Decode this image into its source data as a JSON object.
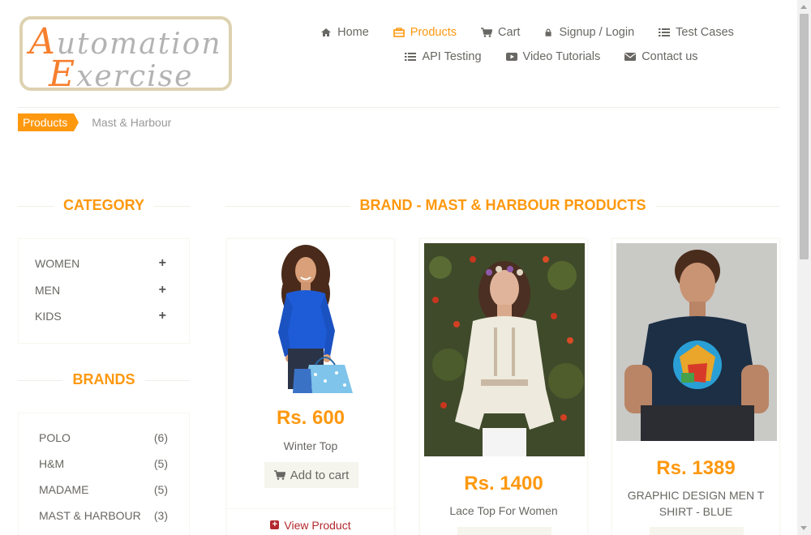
{
  "logo": {
    "line1_cap": "A",
    "line1_rest": "utomation",
    "line2_cap": "E",
    "line2_rest": "xercise"
  },
  "nav": {
    "row1": [
      {
        "label": "Home",
        "icon": "home-icon"
      },
      {
        "label": "Products",
        "icon": "products-icon",
        "active": true
      },
      {
        "label": "Cart",
        "icon": "cart-icon"
      },
      {
        "label": "Signup / Login",
        "icon": "lock-icon"
      },
      {
        "label": "Test Cases",
        "icon": "list-icon"
      }
    ],
    "row2": [
      {
        "label": "API Testing",
        "icon": "list-icon"
      },
      {
        "label": "Video Tutorials",
        "icon": "youtube-icon"
      },
      {
        "label": "Contact us",
        "icon": "envelope-icon"
      }
    ]
  },
  "breadcrumb": {
    "active": "Products",
    "current": "Mast & Harbour"
  },
  "category": {
    "title": "Category",
    "items": [
      {
        "label": "WOMEN"
      },
      {
        "label": "MEN"
      },
      {
        "label": "KIDS"
      }
    ]
  },
  "brands": {
    "title": "Brands",
    "items": [
      {
        "label": "POLO",
        "count": "(6)"
      },
      {
        "label": "H&M",
        "count": "(5)"
      },
      {
        "label": "MADAME",
        "count": "(5)"
      },
      {
        "label": "MAST & HARBOUR",
        "count": "(3)"
      }
    ]
  },
  "main": {
    "title": "Brand - Mast & Harbour Products",
    "products": [
      {
        "price": "Rs. 600",
        "name": "Winter Top",
        "cart_label": "Add to cart",
        "view_label": "View Product"
      },
      {
        "price": "Rs. 1400",
        "name": "Lace Top For Women"
      },
      {
        "price": "Rs. 1389",
        "name": "GRAPHIC DESIGN MEN T SHIRT - BLUE"
      }
    ]
  },
  "colors": {
    "accent": "#fe980f",
    "text": "#696763",
    "view_link": "#b3282d"
  }
}
